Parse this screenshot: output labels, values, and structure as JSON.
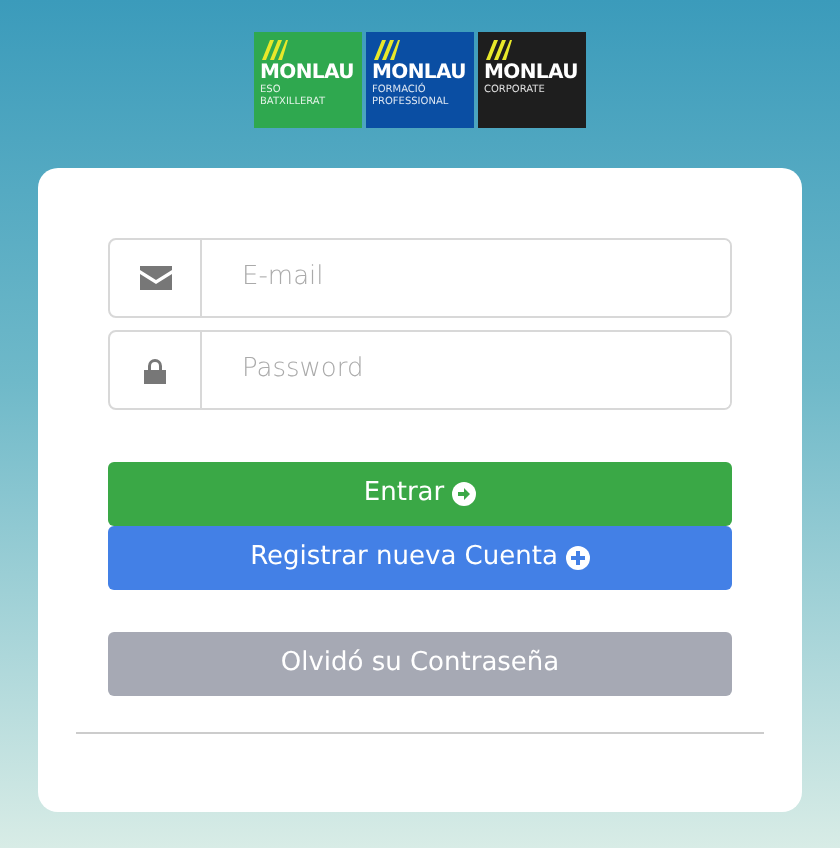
{
  "logos": [
    {
      "name": "MONLAU",
      "lines": [
        "ESO",
        "BATXILLERAT"
      ],
      "color": "#2fa84f"
    },
    {
      "name": "MONLAU",
      "lines": [
        "FORMACIÓ",
        "PROFESSIONAL"
      ],
      "color": "#0a4ea3"
    },
    {
      "name": "MONLAU",
      "lines": [
        "CORPORATE"
      ],
      "color": "#1e1e1e"
    }
  ],
  "fields": [
    {
      "kind": "email",
      "placeholder": "E-mail"
    },
    {
      "kind": "password",
      "placeholder": "Password"
    }
  ],
  "buttons": [
    {
      "kind": "enter",
      "label": "Entrar"
    },
    {
      "kind": "register",
      "label": "Registrar nueva Cuenta"
    },
    {
      "kind": "forgot",
      "label": "Olvidó su Contraseña"
    }
  ]
}
